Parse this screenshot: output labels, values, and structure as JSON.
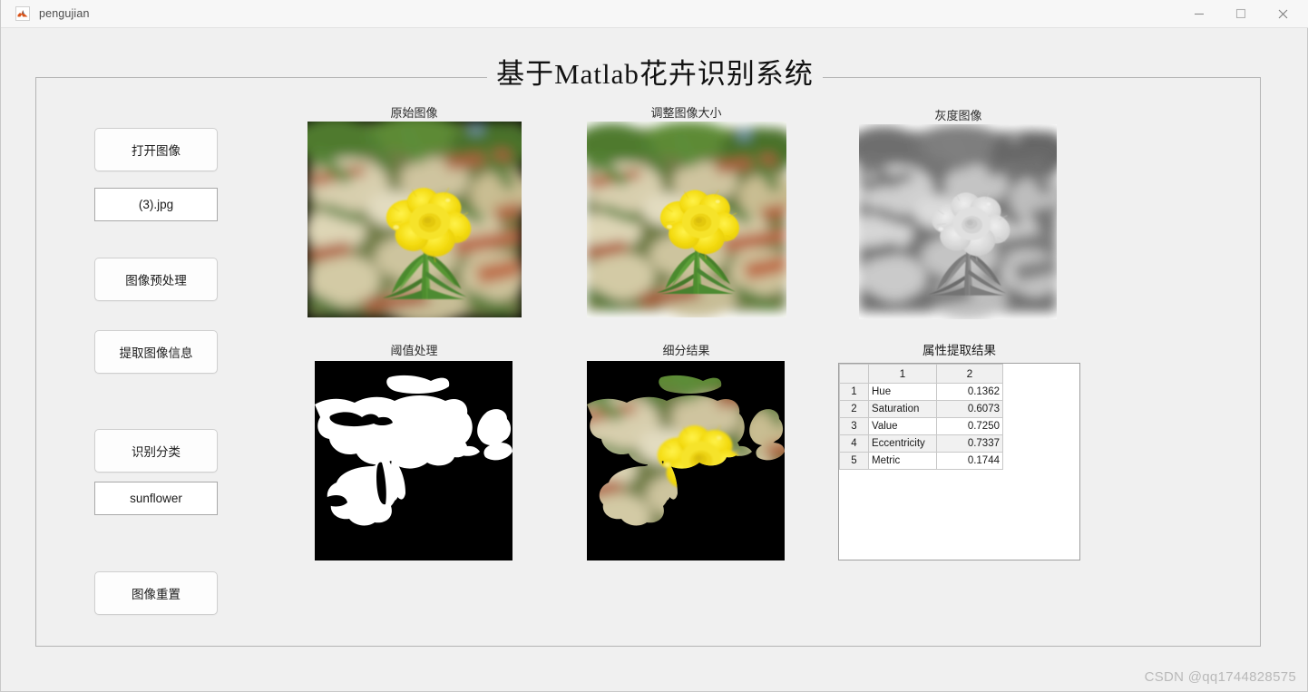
{
  "window": {
    "title": "pengujian",
    "icon": "matlab-icon",
    "controls": {
      "minimize": "minimize-icon",
      "maximize": "maximize-icon",
      "close": "close-icon"
    }
  },
  "panel": {
    "title": "基于Matlab花卉识别系统"
  },
  "controls": [
    {
      "id": "open-image",
      "label": "打开图像",
      "type": "button"
    },
    {
      "id": "filename",
      "label": "(3).jpg",
      "type": "field"
    },
    {
      "id": "preprocess",
      "label": "图像预处理",
      "type": "button"
    },
    {
      "id": "extract-info",
      "label": "提取图像信息",
      "type": "button"
    },
    {
      "id": "classify",
      "label": "识别分类",
      "type": "button"
    },
    {
      "id": "classify-result",
      "label": "sunflower",
      "type": "field"
    },
    {
      "id": "reset-image",
      "label": "图像重置",
      "type": "button"
    }
  ],
  "axes": [
    {
      "id": "original",
      "label": "原始图像"
    },
    {
      "id": "resized",
      "label": "调整图像大小"
    },
    {
      "id": "grayscale",
      "label": "灰度图像"
    },
    {
      "id": "threshold",
      "label": "阈值处理"
    },
    {
      "id": "segmented",
      "label": "细分结果"
    }
  ],
  "table": {
    "title": "属性提取结果",
    "columns": [
      "",
      "1",
      "2"
    ],
    "rows": [
      {
        "index": "1",
        "name": "Hue",
        "value": "0.1362"
      },
      {
        "index": "2",
        "name": "Saturation",
        "value": "0.6073"
      },
      {
        "index": "3",
        "name": "Value",
        "value": "0.7250"
      },
      {
        "index": "4",
        "name": "Eccentricity",
        "value": "0.7337"
      },
      {
        "index": "5",
        "name": "Metric",
        "value": "0.1744"
      }
    ]
  },
  "watermark": "CSDN @qq1744828575",
  "colors": {
    "background": "#f0f0f0",
    "titlebar": "#f7f7f7",
    "panel_border": "#b4b4b4",
    "button_face": "#fdfdfd",
    "flower_yellow": "#f2dc17",
    "leaf_green": "#4e8a34",
    "watermark": "#b9b9b9"
  }
}
